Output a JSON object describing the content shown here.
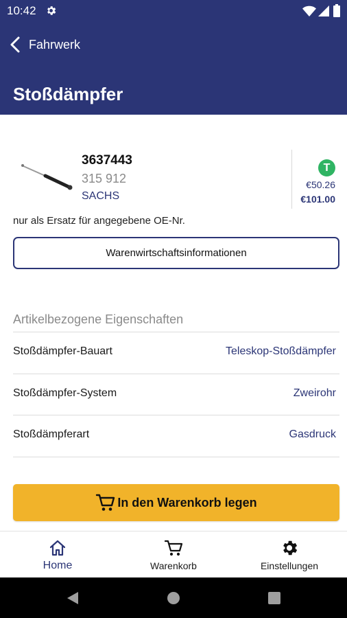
{
  "status_bar": {
    "time": "10:42"
  },
  "header": {
    "back_label": "Fahrwerk",
    "title": "Stoßdämpfer"
  },
  "product": {
    "article_number": "3637443",
    "oe_number": "315 912",
    "brand": "SACHS",
    "availability_badge": "T",
    "price_net": "€50.26",
    "price_gross": "€101.00",
    "note": "nur als Ersatz für angegebene OE-Nr."
  },
  "inventory_button_label": "Warenwirtschaftsinformationen",
  "properties": {
    "heading": "Artikelbezogene Eigenschaften",
    "rows": [
      {
        "key": "Stoßdämpfer-Bauart",
        "value": "Teleskop-Stoßdämpfer"
      },
      {
        "key": "Stoßdämpfer-System",
        "value": "Zweirohr"
      },
      {
        "key": "Stoßdämpferart",
        "value": "Gasdruck"
      }
    ]
  },
  "add_to_cart_label": "In den Warenkorb legen",
  "bottom_nav": {
    "items": [
      {
        "label": "Home",
        "icon": "home-icon"
      },
      {
        "label": "Warenkorb",
        "icon": "cart-icon"
      },
      {
        "label": "Einstellungen",
        "icon": "gear-icon"
      }
    ],
    "active": "Home"
  },
  "colors": {
    "primary": "#2b3576",
    "accent": "#f1b32a",
    "badge_green": "#2fb463"
  }
}
